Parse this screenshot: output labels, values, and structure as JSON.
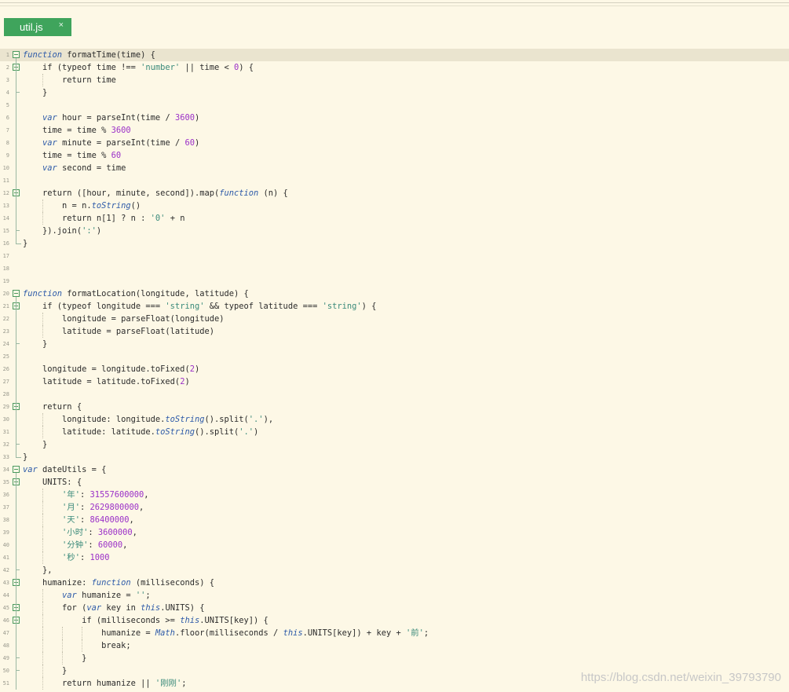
{
  "tab": {
    "label": "util.js",
    "close_glyph": "×"
  },
  "watermark": "https://blog.csdn.net/weixin_39793790",
  "lines": [
    {
      "n": "1",
      "t": "function formatTime(time) {"
    },
    {
      "n": "2",
      "t": "    if (typeof time !== 'number' || time < 0) {"
    },
    {
      "n": "3",
      "t": "        return time"
    },
    {
      "n": "4",
      "t": "    }"
    },
    {
      "n": "5",
      "t": ""
    },
    {
      "n": "6",
      "t": "    var hour = parseInt(time / 3600)"
    },
    {
      "n": "7",
      "t": "    time = time % 3600"
    },
    {
      "n": "8",
      "t": "    var minute = parseInt(time / 60)"
    },
    {
      "n": "9",
      "t": "    time = time % 60"
    },
    {
      "n": "10",
      "t": "    var second = time"
    },
    {
      "n": "11",
      "t": ""
    },
    {
      "n": "12",
      "t": "    return ([hour, minute, second]).map(function (n) {"
    },
    {
      "n": "13",
      "t": "        n = n.toString()"
    },
    {
      "n": "14",
      "t": "        return n[1] ? n : '0' + n"
    },
    {
      "n": "15",
      "t": "    }).join(':')"
    },
    {
      "n": "16",
      "t": "}"
    },
    {
      "n": "17",
      "t": ""
    },
    {
      "n": "18",
      "t": ""
    },
    {
      "n": "19",
      "t": ""
    },
    {
      "n": "20",
      "t": "function formatLocation(longitude, latitude) {"
    },
    {
      "n": "21",
      "t": "    if (typeof longitude === 'string' && typeof latitude === 'string') {"
    },
    {
      "n": "22",
      "t": "        longitude = parseFloat(longitude)"
    },
    {
      "n": "23",
      "t": "        latitude = parseFloat(latitude)"
    },
    {
      "n": "24",
      "t": "    }"
    },
    {
      "n": "25",
      "t": ""
    },
    {
      "n": "26",
      "t": "    longitude = longitude.toFixed(2)"
    },
    {
      "n": "27",
      "t": "    latitude = latitude.toFixed(2)"
    },
    {
      "n": "28",
      "t": ""
    },
    {
      "n": "29",
      "t": "    return {"
    },
    {
      "n": "30",
      "t": "        longitude: longitude.toString().split('.'),"
    },
    {
      "n": "31",
      "t": "        latitude: latitude.toString().split('.')"
    },
    {
      "n": "32",
      "t": "    }"
    },
    {
      "n": "33",
      "t": "}"
    },
    {
      "n": "34",
      "t": "var dateUtils = {"
    },
    {
      "n": "35",
      "t": "    UNITS: {"
    },
    {
      "n": "36",
      "t": "        '年': 31557600000,"
    },
    {
      "n": "37",
      "t": "        '月': 2629800000,"
    },
    {
      "n": "38",
      "t": "        '天': 86400000,"
    },
    {
      "n": "39",
      "t": "        '小时': 3600000,"
    },
    {
      "n": "40",
      "t": "        '分钟': 60000,"
    },
    {
      "n": "41",
      "t": "        '秒': 1000"
    },
    {
      "n": "42",
      "t": "    },"
    },
    {
      "n": "43",
      "t": "    humanize: function (milliseconds) {"
    },
    {
      "n": "44",
      "t": "        var humanize = '';"
    },
    {
      "n": "45",
      "t": "        for (var key in this.UNITS) {"
    },
    {
      "n": "46",
      "t": "            if (milliseconds >= this.UNITS[key]) {"
    },
    {
      "n": "47",
      "t": "                humanize = Math.floor(milliseconds / this.UNITS[key]) + key + '前';"
    },
    {
      "n": "48",
      "t": "                break;"
    },
    {
      "n": "49",
      "t": "            }"
    },
    {
      "n": "50",
      "t": "        }"
    },
    {
      "n": "51",
      "t": "        return humanize || '刚刚';"
    }
  ]
}
